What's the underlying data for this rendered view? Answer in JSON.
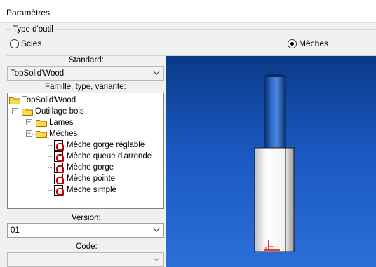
{
  "window": {
    "title": "Paramètres"
  },
  "tool_type": {
    "legend": "Type d'outil",
    "options": [
      {
        "label": "Scies",
        "selected": false
      },
      {
        "label": "Mèches",
        "selected": true
      }
    ]
  },
  "standard": {
    "label": "Standard:",
    "value": "TopSolid'Wood"
  },
  "family": {
    "label": "Famille, type, variante:",
    "tree": {
      "root": "TopSolid'Wood",
      "outillage": "Outillage bois",
      "lames": "Lames",
      "meches": "Mèches",
      "items": [
        "Mèche gorge réglable",
        "Mèche queue d'arronde",
        "Mèche gorge",
        "Mèche pointe",
        "Mèche simple"
      ]
    }
  },
  "version": {
    "label": "Version:",
    "value": "01"
  },
  "code": {
    "label": "Code:",
    "value": ""
  },
  "colors": {
    "viewport_top": "#0a3a86",
    "viewport_bottom": "#2a6fd8",
    "folder": "#ffd84a"
  }
}
